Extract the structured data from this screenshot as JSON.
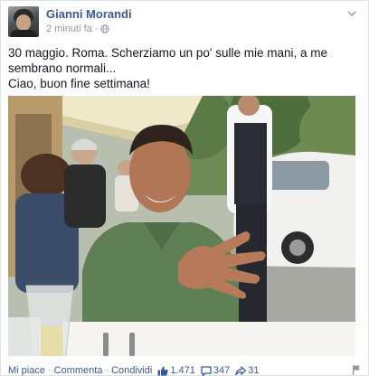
{
  "post": {
    "author": "Gianni Morandi",
    "time": "2 minuti fa",
    "privacy_icon": "globe-icon",
    "menu_icon": "chevron-down-icon",
    "text_lines": [
      "30 maggio. Roma. Scherziamo un po' sulle mie mani, a me sembrano normali...",
      "Ciao, buon fine settimana!"
    ],
    "photo": {
      "subject": "Man in green polo at outdoor restaurant table showing his hand"
    }
  },
  "actions": {
    "like": "Mi piace",
    "comment": "Commenta",
    "share": "Condividi",
    "separator": "·"
  },
  "stats": {
    "likes": "1.471",
    "comments": "347",
    "shares": "31"
  },
  "colors": {
    "link": "#3b5998",
    "meta": "#9197a3",
    "text": "#141823"
  }
}
